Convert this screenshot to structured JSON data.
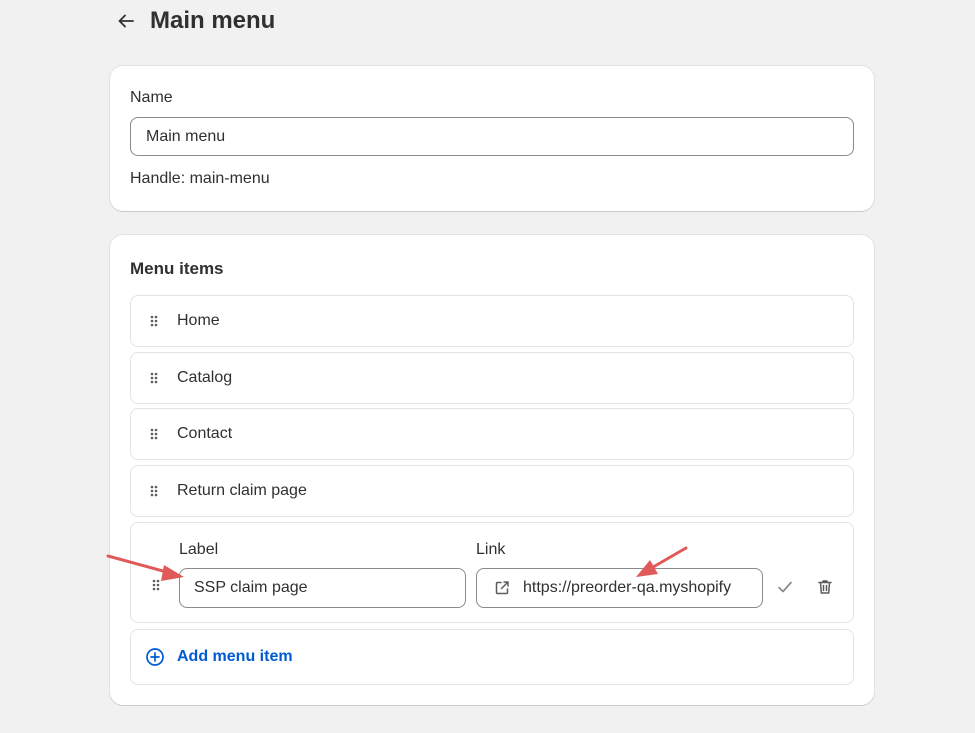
{
  "header": {
    "title": "Main menu"
  },
  "name_card": {
    "label": "Name",
    "value": "Main menu",
    "handle_text": "Handle: main-menu"
  },
  "menu_card": {
    "title": "Menu items",
    "items": [
      {
        "label": "Home"
      },
      {
        "label": "Catalog"
      },
      {
        "label": "Contact"
      },
      {
        "label": "Return claim page"
      }
    ],
    "editing": {
      "label_caption": "Label",
      "label_value": "SSP claim page",
      "link_caption": "Link",
      "link_value": "https://preorder-qa.myshopify"
    },
    "add_button": "Add menu item"
  },
  "icons": {
    "back": "arrow-left-icon",
    "drag": "drag-handle-icon",
    "external_link": "external-link-icon",
    "confirm": "checkmark-icon",
    "delete": "trash-icon",
    "add": "plus-circle-icon"
  },
  "colors": {
    "background": "#f1f1f1",
    "card": "#ffffff",
    "accent_link": "#005bd3",
    "annotation_arrow": "#e05a5a"
  }
}
